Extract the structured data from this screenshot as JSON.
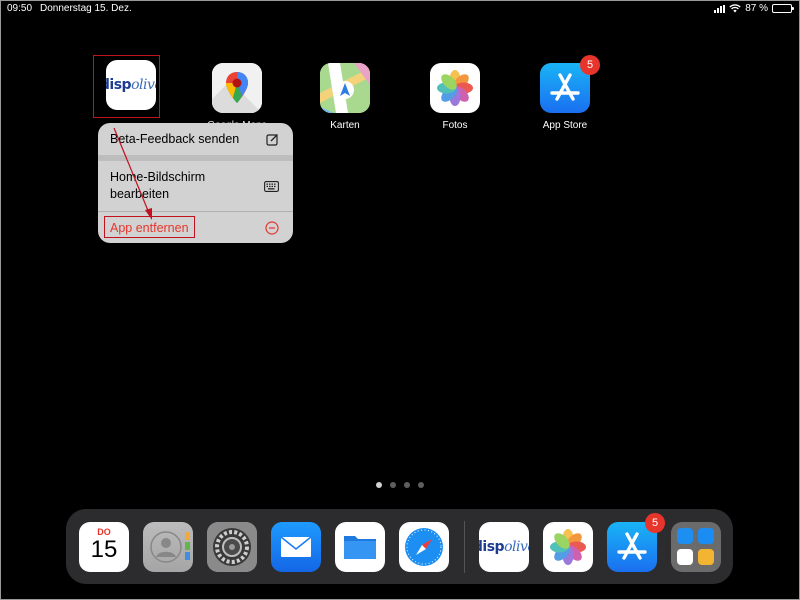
{
  "status_bar": {
    "time": "09:50",
    "date": "Donnerstag 15. Dez.",
    "battery": "87 %",
    "battery_level": 0.87
  },
  "home_apps": [
    {
      "name": "dispolive",
      "label": "",
      "logo_a": "disp",
      "logo_b": "olive"
    },
    {
      "name": "Google Maps",
      "label": "Google Maps"
    },
    {
      "name": "Karten",
      "label": "Karten"
    },
    {
      "name": "Fotos",
      "label": "Fotos"
    },
    {
      "name": "App Store",
      "label": "App Store",
      "badge": "5"
    }
  ],
  "context_menu": {
    "items": [
      {
        "label": "Beta-Feedback senden",
        "icon": "edit-icon"
      },
      {
        "label_line1": "Home-Bildschirm",
        "label_line2": "bearbeiten",
        "icon": "keyboard-icon"
      },
      {
        "label": "App entfernen",
        "icon": "minus-circle-icon"
      }
    ]
  },
  "page_indicator": {
    "count": 4,
    "active": 0
  },
  "dock": {
    "calendar": {
      "day": "DO",
      "date": "15"
    },
    "apps": [
      "Kalender",
      "Kontakte",
      "Einstellungen",
      "Mail",
      "Dateien",
      "Safari",
      "dispolive",
      "Fotos",
      "App Store",
      "Ordner"
    ],
    "app_store_badge": "5"
  },
  "colors": {
    "background": "#000000",
    "annotation_red": "#c1121f",
    "destructive": "#e8352c",
    "badge": "#e8352c"
  }
}
